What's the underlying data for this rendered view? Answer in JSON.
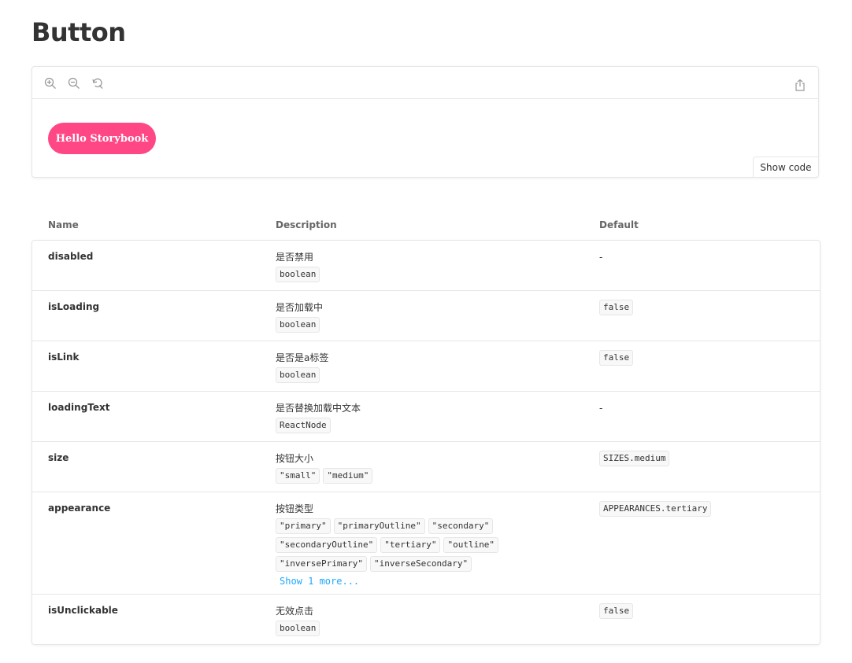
{
  "page": {
    "title": "Button"
  },
  "preview": {
    "toolbar": {
      "zoom_in_icon": "zoom-in-icon",
      "zoom_out_icon": "zoom-out-icon",
      "reset_icon": "reset-zoom-icon",
      "share_icon": "share-icon"
    },
    "demo_button_label": "Hello Storybook",
    "show_code_label": "Show code",
    "accent_color": "#ff4785"
  },
  "props_table": {
    "headers": {
      "name": "Name",
      "description": "Description",
      "default": "Default"
    },
    "rows": [
      {
        "name": "disabled",
        "description": "是否禁用",
        "types": [
          "boolean"
        ],
        "default": "-"
      },
      {
        "name": "isLoading",
        "description": "是否加载中",
        "types": [
          "boolean"
        ],
        "default": "false"
      },
      {
        "name": "isLink",
        "description": "是否是a标签",
        "types": [
          "boolean"
        ],
        "default": "false"
      },
      {
        "name": "loadingText",
        "description": "是否替换加载中文本",
        "types": [
          "ReactNode"
        ],
        "default": "-"
      },
      {
        "name": "size",
        "description": "按钮大小",
        "types": [
          "\"small\"",
          "\"medium\""
        ],
        "default": "SIZES.medium"
      },
      {
        "name": "appearance",
        "description": "按钮类型",
        "types": [
          "\"primary\"",
          "\"primaryOutline\"",
          "\"secondary\"",
          "\"secondaryOutline\"",
          "\"tertiary\"",
          "\"outline\"",
          "\"inversePrimary\"",
          "\"inverseSecondary\""
        ],
        "show_more": "Show 1 more...",
        "default": "APPEARANCES.tertiary"
      },
      {
        "name": "isUnclickable",
        "description": "无效点击",
        "types": [
          "boolean"
        ],
        "default": "false"
      }
    ],
    "link_color": "#1ea7fd"
  }
}
